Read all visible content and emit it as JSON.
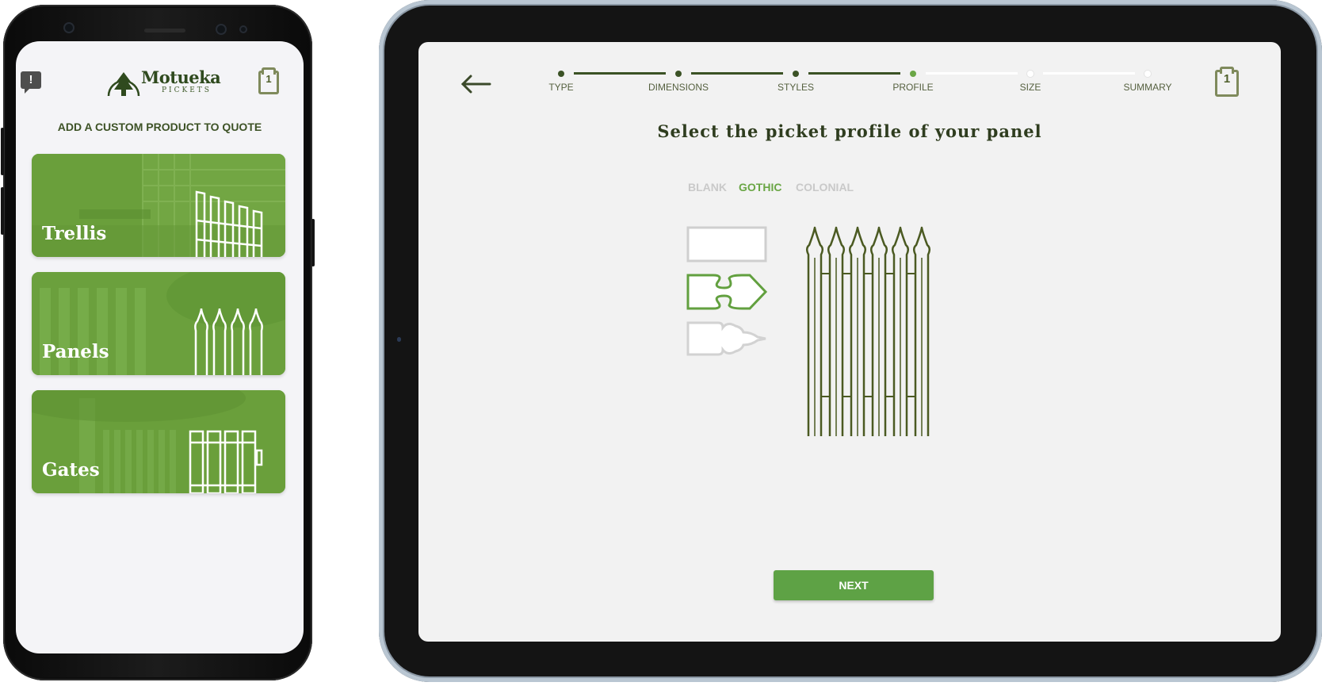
{
  "phone": {
    "logo": {
      "name": "Motueka",
      "sub": "PICKETS"
    },
    "cart_count": "1",
    "message_icon": "alert-message-icon",
    "heading": "ADD A CUSTOM PRODUCT TO QUOTE",
    "products": [
      {
        "label": "Trellis",
        "icon": "trellis-icon"
      },
      {
        "label": "Panels",
        "icon": "gothic-panel-icon"
      },
      {
        "label": "Gates",
        "icon": "gate-icon"
      }
    ]
  },
  "tablet": {
    "back_icon": "back-arrow-icon",
    "cart_count": "1",
    "steps": [
      {
        "label": "TYPE",
        "state": "done"
      },
      {
        "label": "DIMENSIONS",
        "state": "done"
      },
      {
        "label": "STYLES",
        "state": "done"
      },
      {
        "label": "PROFILE",
        "state": "active"
      },
      {
        "label": "SIZE",
        "state": "future"
      },
      {
        "label": "SUMMARY",
        "state": "future"
      }
    ],
    "title": "Select the picket profile of your panel",
    "profile_options": [
      {
        "label": "BLANK",
        "selected": false
      },
      {
        "label": "GOTHIC",
        "selected": true
      },
      {
        "label": "COLONIAL",
        "selected": false
      }
    ],
    "next_label": "NEXT"
  },
  "colors": {
    "brand_green": "#6aa645",
    "dark_green": "#3b5225",
    "card_green": "#6a9f3b",
    "muted": "#c9c9c9"
  }
}
